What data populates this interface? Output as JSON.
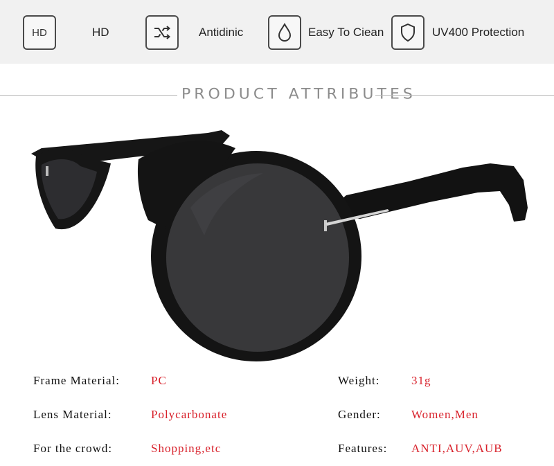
{
  "features": [
    {
      "icon_text": "HD",
      "icon": "hd-icon",
      "label": "HD"
    },
    {
      "icon_text": "",
      "icon": "shuffle-arrows-icon",
      "label": "Antidinic"
    },
    {
      "icon_text": "",
      "icon": "water-drop-icon",
      "label": "Easy To Ciean"
    },
    {
      "icon_text": "",
      "icon": "shield-icon",
      "label": "UV400 Protection"
    }
  ],
  "section_title": "PRODUCT ATTRIBUTES",
  "attributes": {
    "left": [
      {
        "label": "Frame Material:",
        "value": "PC"
      },
      {
        "label": "Lens Material:",
        "value": "Polycarbonate"
      },
      {
        "label": "For the crowd:",
        "value": "Shopping,etc"
      }
    ],
    "right": [
      {
        "label": "Weight:",
        "value": "31g"
      },
      {
        "label": "Gender:",
        "value": "Women,Men"
      },
      {
        "label": "Features:",
        "value": "ANTI,AUV,AUB"
      }
    ]
  },
  "colors": {
    "value_text": "#d8202a",
    "header_bg": "#f1f1f1",
    "frame": "#141414",
    "lens": "#3a3a3c"
  }
}
